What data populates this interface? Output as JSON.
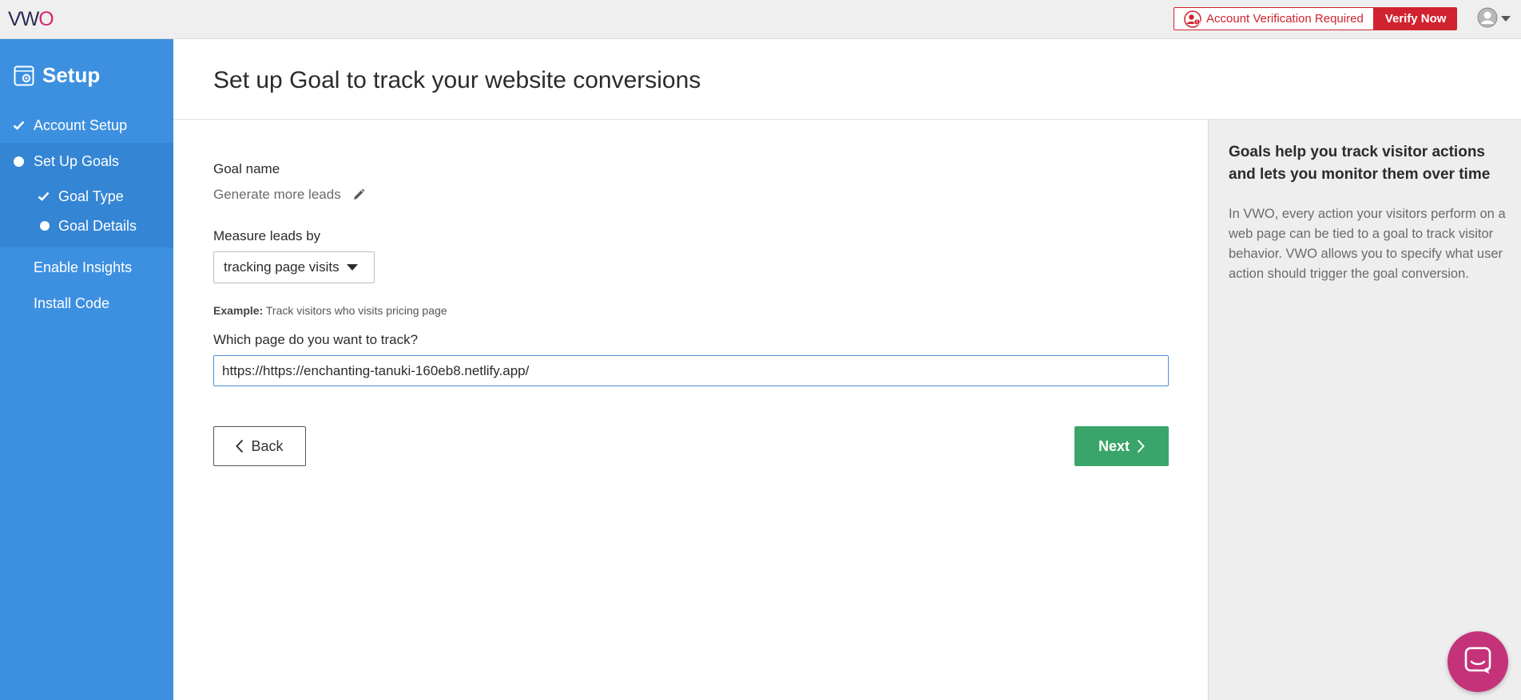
{
  "topbar": {
    "logo": {
      "v": "V",
      "w": "W",
      "o": "O"
    },
    "verification_text": "Account Verification Required",
    "verify_button": "Verify Now",
    "colors": {
      "alert": "#d0232f",
      "logo_accent": "#d6246e"
    },
    "icons": [
      "user-warning-icon",
      "user-avatar-icon",
      "caret-down-icon"
    ]
  },
  "sidebar": {
    "title": "Setup",
    "title_icon": "setup-gear-icon",
    "background": "#3d90e0",
    "items": [
      {
        "label": "Account Setup",
        "state": "done"
      },
      {
        "label": "Set Up Goals",
        "state": "current"
      },
      {
        "label": "Enable Insights",
        "state": "pending"
      },
      {
        "label": "Install Code",
        "state": "pending"
      }
    ],
    "subitems": [
      {
        "label": "Goal Type",
        "state": "done"
      },
      {
        "label": "Goal Details",
        "state": "current"
      }
    ]
  },
  "main": {
    "title": "Set up Goal to track your website conversions",
    "goal_name_label": "Goal name",
    "goal_name_value": "Generate more leads",
    "measure_label": "Measure leads by",
    "measure_selected": "tracking page visits",
    "example_prefix": "Example:",
    "example_text": "Track visitors who visits pricing page",
    "page_label": "Which page do you want to track?",
    "page_url_value": "https://https://enchanting-tanuki-160eb8.netlify.app/",
    "back_button": "Back",
    "next_button": "Next",
    "next_color": "#3aa56a"
  },
  "help": {
    "title": "Goals help you track visitor actions and lets you monitor them over time",
    "body": "In VWO, every action your visitors perform on a web page can be tied to a goal to track visitor behavior. VWO allows you to specify what user action should trigger the goal conversion."
  },
  "chat": {
    "icon": "chat-bubble-icon",
    "color": "#c4327a"
  }
}
